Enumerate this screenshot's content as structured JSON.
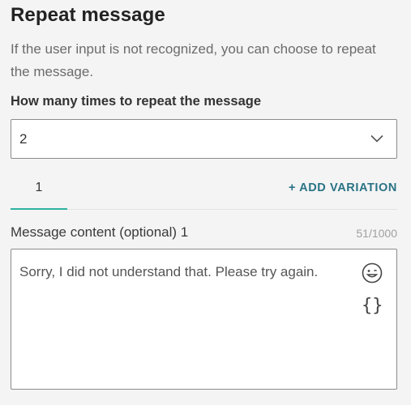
{
  "section": {
    "title": "Repeat message",
    "description": "If the user input is not recognized, you can choose to repeat the message."
  },
  "repeat_select": {
    "label": "How many times to repeat the message",
    "value": "2"
  },
  "tabs": {
    "items": [
      {
        "label": "1",
        "active": true
      }
    ],
    "add_variation_label": "+ ADD VARIATION"
  },
  "message": {
    "label": "Message content (optional) 1",
    "counter": "51/1000",
    "text": "Sorry, I did not understand that. Please try again."
  },
  "icons": {
    "chevron": "chevron-down-icon",
    "emoji": "emoji-icon",
    "variables": "curly-braces-icon"
  },
  "colors": {
    "accent_teal": "#2cb3a1",
    "link_blue": "#2a7386",
    "background": "#f4f4f4"
  }
}
